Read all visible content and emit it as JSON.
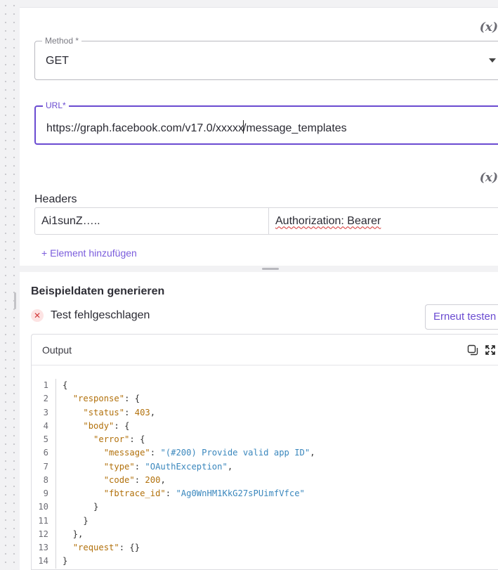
{
  "request_config": {
    "method": {
      "label": "Method *",
      "value": "GET"
    },
    "url": {
      "label": "URL*",
      "value_before_cursor": "https://graph.facebook.com/v17.0/xxxxx",
      "value_after_cursor": "/message_templates"
    },
    "fx_label": "(x)",
    "headers": {
      "label": "Headers",
      "rows": [
        {
          "value": "Ai1sunZ…..",
          "key": "Authorization: Bearer"
        }
      ],
      "add_label": "+ Element hinzufügen"
    }
  },
  "sample_data": {
    "title": "Beispieldaten generieren",
    "status_text": "Test fehlgeschlagen",
    "retry_label": "Erneut testen",
    "output_title": "Output",
    "code_lines": [
      {
        "n": "1",
        "tokens": [
          [
            "p",
            "{"
          ]
        ]
      },
      {
        "n": "2",
        "tokens": [
          [
            "p",
            "  "
          ],
          [
            "k",
            "\"response\""
          ],
          [
            "p",
            ": {"
          ]
        ]
      },
      {
        "n": "3",
        "tokens": [
          [
            "p",
            "    "
          ],
          [
            "k",
            "\"status\""
          ],
          [
            "p",
            ": "
          ],
          [
            "n",
            "403"
          ],
          [
            "p",
            ","
          ]
        ]
      },
      {
        "n": "4",
        "tokens": [
          [
            "p",
            "    "
          ],
          [
            "k",
            "\"body\""
          ],
          [
            "p",
            ": {"
          ]
        ]
      },
      {
        "n": "5",
        "tokens": [
          [
            "p",
            "      "
          ],
          [
            "k",
            "\"error\""
          ],
          [
            "p",
            ": {"
          ]
        ]
      },
      {
        "n": "6",
        "tokens": [
          [
            "p",
            "        "
          ],
          [
            "k",
            "\"message\""
          ],
          [
            "p",
            ": "
          ],
          [
            "s",
            "\"(#200) Provide valid app ID\""
          ],
          [
            "p",
            ","
          ]
        ]
      },
      {
        "n": "7",
        "tokens": [
          [
            "p",
            "        "
          ],
          [
            "k",
            "\"type\""
          ],
          [
            "p",
            ": "
          ],
          [
            "s",
            "\"OAuthException\""
          ],
          [
            "p",
            ","
          ]
        ]
      },
      {
        "n": "8",
        "tokens": [
          [
            "p",
            "        "
          ],
          [
            "k",
            "\"code\""
          ],
          [
            "p",
            ": "
          ],
          [
            "n",
            "200"
          ],
          [
            "p",
            ","
          ]
        ]
      },
      {
        "n": "9",
        "tokens": [
          [
            "p",
            "        "
          ],
          [
            "k",
            "\"fbtrace_id\""
          ],
          [
            "p",
            ": "
          ],
          [
            "s",
            "\"Ag0WnHM1KkG27sPUimfVfce\""
          ]
        ]
      },
      {
        "n": "10",
        "tokens": [
          [
            "p",
            "      }"
          ]
        ]
      },
      {
        "n": "11",
        "tokens": [
          [
            "p",
            "    }"
          ]
        ]
      },
      {
        "n": "12",
        "tokens": [
          [
            "p",
            "  },"
          ]
        ]
      },
      {
        "n": "13",
        "tokens": [
          [
            "p",
            "  "
          ],
          [
            "k",
            "\"request\""
          ],
          [
            "p",
            ": {}"
          ]
        ]
      },
      {
        "n": "14",
        "tokens": [
          [
            "p",
            "}"
          ]
        ]
      }
    ]
  },
  "colors": {
    "accent": "#6a4bd1",
    "error": "#d23b3b",
    "json_key": "#b2710c",
    "json_string": "#3a87bd"
  }
}
